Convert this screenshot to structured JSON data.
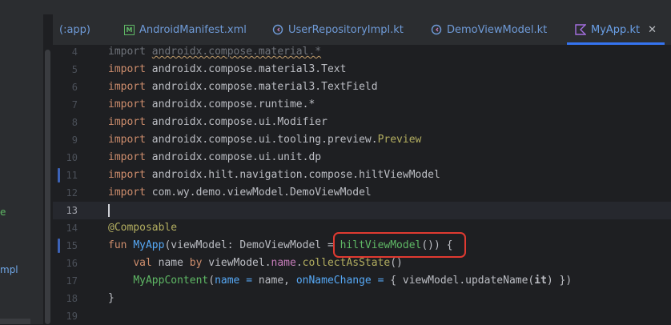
{
  "left_panel": {
    "fragments": [
      "e",
      "mpl"
    ]
  },
  "tabs": [
    {
      "label": "(:app)",
      "icon": "",
      "active": false
    },
    {
      "label": "AndroidManifest.xml",
      "icon": "manifest-icon",
      "active": false
    },
    {
      "label": "UserRepositoryImpl.kt",
      "icon": "kotlin-class-icon",
      "active": false
    },
    {
      "label": "DemoViewModel.kt",
      "icon": "kotlin-class-icon",
      "active": false
    },
    {
      "label": "MyApp.kt",
      "icon": "kotlin-file-icon",
      "active": true
    }
  ],
  "editor": {
    "line_numbers": [
      "4",
      "5",
      "6",
      "7",
      "8",
      "9",
      "10",
      "11",
      "12",
      "13",
      "14",
      "15",
      "16",
      "17",
      "18",
      "19"
    ],
    "lines": {
      "l4_kw": "import",
      "l4_rest": "androidx.compose.material.*",
      "l5_kw": "import",
      "l5_rest": "androidx.compose.material3.Text",
      "l6_kw": "import",
      "l6_rest": "androidx.compose.material3.TextField",
      "l7_kw": "import",
      "l7_rest": "androidx.compose.runtime.*",
      "l8_kw": "import",
      "l8_rest": "androidx.compose.ui.Modifier",
      "l9_kw": "import",
      "l9_rest": "androidx.compose.ui.tooling.preview.",
      "l9_hl": "Preview",
      "l10_kw": "import",
      "l10_rest": "androidx.compose.ui.unit.dp",
      "l11_kw": "import",
      "l11_rest": "androidx.hilt.navigation.compose.hiltViewModel",
      "l12_kw": "import",
      "l12_rest": "com.wy.demo.viewModel.DemoViewModel",
      "l14_ann": "@Composable",
      "l15_kw": "fun",
      "l15_fn": "MyApp",
      "l15_mid": "(viewModel: DemoViewModel = ",
      "l15_call": "hiltViewModel",
      "l15_end": "()) {",
      "l16_kw": "val",
      "l16_a": " name ",
      "l16_by": "by",
      "l16_b": " viewModel.",
      "l16_prop": "name",
      "l16_c": ".",
      "l16_call": "collectAsState",
      "l16_d": "()",
      "l17_call": "MyAppContent",
      "l17_a": "(",
      "l17_n1": "name =",
      "l17_b": " name, ",
      "l17_n2": "onNameChange =",
      "l17_c": " { viewModel.updateName(",
      "l17_it": "it",
      "l17_d": ") })",
      "l18": "}"
    },
    "colors": {
      "highlight_box": "#e03a31",
      "tab_accent": "#3574f0"
    }
  }
}
